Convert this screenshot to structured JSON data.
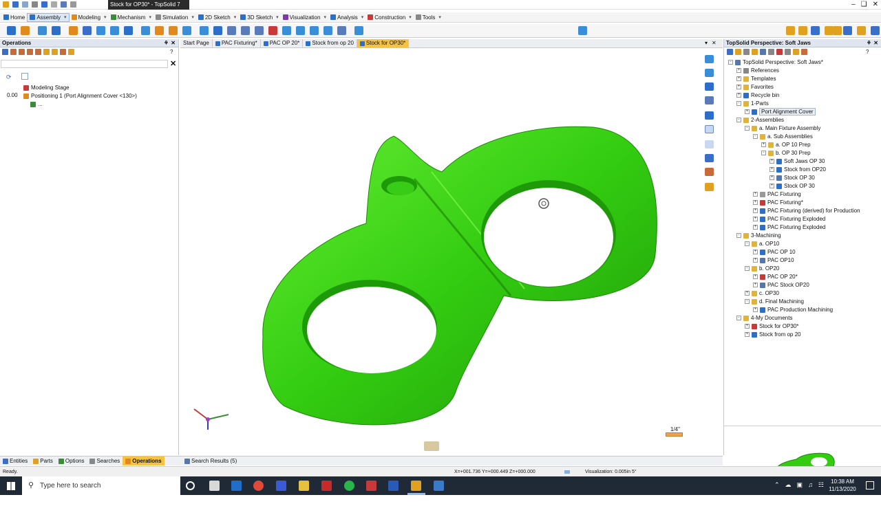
{
  "window": {
    "title": "Stock for OP30* - TopSolid 7"
  },
  "menus": [
    {
      "label": "Home",
      "color": "#2d6ec8",
      "active": false,
      "dropdown": false
    },
    {
      "label": "Assembly",
      "color": "#2d6ec8",
      "active": true,
      "dropdown": true
    },
    {
      "label": "Modeling",
      "color": "#e08a1e",
      "active": false,
      "dropdown": true
    },
    {
      "label": "Mechanism",
      "color": "#3a8c3a",
      "active": false,
      "dropdown": true
    },
    {
      "label": "Simulation",
      "color": "#888888",
      "active": false,
      "dropdown": true
    },
    {
      "label": "2D Sketch",
      "color": "#2d6ec8",
      "active": false,
      "dropdown": true
    },
    {
      "label": "3D Sketch",
      "color": "#2d6ec8",
      "active": false,
      "dropdown": true
    },
    {
      "label": "Visualization",
      "color": "#7a3aa8",
      "active": false,
      "dropdown": true
    },
    {
      "label": "Analysis",
      "color": "#2d6ec8",
      "active": false,
      "dropdown": true
    },
    {
      "label": "Construction",
      "color": "#c83a3a",
      "active": false,
      "dropdown": true
    },
    {
      "label": "Tools",
      "color": "#888888",
      "active": false,
      "dropdown": true
    }
  ],
  "left_panel": {
    "title": "Operations",
    "value_label": "0.00",
    "tree": [
      {
        "label": "Modeling Stage",
        "icon_color": "#c83a3a"
      },
      {
        "label": "Positioning 1 (Port Alignment Cover <130>)",
        "icon_color": "#e08a1e"
      },
      {
        "label": "...",
        "icon_color": "#3a8c3a"
      }
    ]
  },
  "doc_tabs": [
    {
      "label": "Start Page",
      "active": false
    },
    {
      "label": "PAC Fixturing*",
      "active": false
    },
    {
      "label": "PAC OP 20*",
      "active": false
    },
    {
      "label": "Stock from op 20",
      "active": false
    },
    {
      "label": "Stock for OP30*",
      "active": true
    }
  ],
  "right_panel": {
    "title": "TopSolid Perspective: Soft Jaws",
    "tree": [
      {
        "label": "TopSolid Perspective: Soft Jaws*",
        "depth": 0,
        "icon": "#5577aa",
        "exp": "-"
      },
      {
        "label": "References",
        "depth": 1,
        "icon": "#888888",
        "exp": "+"
      },
      {
        "label": "Templates",
        "depth": 1,
        "icon": "#e0b43a",
        "exp": "+"
      },
      {
        "label": "Favorites",
        "depth": 1,
        "icon": "#e0b43a",
        "exp": "+"
      },
      {
        "label": "Recycle bin",
        "depth": 1,
        "icon": "#2d6ec8",
        "exp": "+"
      },
      {
        "label": "1-Parts",
        "depth": 1,
        "icon": "#e0b43a",
        "exp": "-"
      },
      {
        "label": "Port Alignment Cover",
        "depth": 2,
        "icon": "#2d6ec8",
        "exp": "+",
        "highlight": true
      },
      {
        "label": "2-Assemblies",
        "depth": 1,
        "icon": "#e0b43a",
        "exp": "-"
      },
      {
        "label": "a. Main Fixture Assembly",
        "depth": 2,
        "icon": "#e0b43a",
        "exp": "-"
      },
      {
        "label": "a. Sub Assemblies",
        "depth": 3,
        "icon": "#e0b43a",
        "exp": "-"
      },
      {
        "label": "a. OP 10 Prep",
        "depth": 4,
        "icon": "#e0b43a",
        "exp": "+"
      },
      {
        "label": "b. OP 30 Prep",
        "depth": 4,
        "icon": "#e0b43a",
        "exp": "-"
      },
      {
        "label": "Soft Jaws OP 30",
        "depth": 5,
        "icon": "#2d6ec8",
        "exp": "+"
      },
      {
        "label": "Stock from OP20",
        "depth": 5,
        "icon": "#2d6ec8",
        "exp": "+"
      },
      {
        "label": "Stock OP 30",
        "depth": 5,
        "icon": "#5577aa",
        "exp": "+"
      },
      {
        "label": "Stock OP 30",
        "depth": 5,
        "icon": "#2d6ec8",
        "exp": "+"
      },
      {
        "label": "PAC Fixturing",
        "depth": 3,
        "icon": "#999999",
        "exp": "+"
      },
      {
        "label": "PAC Fixturing*",
        "depth": 3,
        "icon": "#c83a3a",
        "exp": "+"
      },
      {
        "label": "PAC Fixturing (derived) for Production",
        "depth": 3,
        "icon": "#2d6ec8",
        "exp": "+"
      },
      {
        "label": "PAC Fixturing Exploded",
        "depth": 3,
        "icon": "#2d6ec8",
        "exp": "+"
      },
      {
        "label": "PAC Fixturing Exploded",
        "depth": 3,
        "icon": "#2d6ec8",
        "exp": "+"
      },
      {
        "label": "3-Machining",
        "depth": 1,
        "icon": "#e0b43a",
        "exp": "-"
      },
      {
        "label": "a. OP10",
        "depth": 2,
        "icon": "#e0b43a",
        "exp": "-"
      },
      {
        "label": "PAC OP 10",
        "depth": 3,
        "icon": "#2d6ec8",
        "exp": "+"
      },
      {
        "label": "PAC OP10",
        "depth": 3,
        "icon": "#5577aa",
        "exp": "+"
      },
      {
        "label": "b. OP20",
        "depth": 2,
        "icon": "#e0b43a",
        "exp": "-"
      },
      {
        "label": "PAC OP 20*",
        "depth": 3,
        "icon": "#c83a3a",
        "exp": "+"
      },
      {
        "label": "PAC Stock OP20",
        "depth": 3,
        "icon": "#5577aa",
        "exp": "+"
      },
      {
        "label": "c. OP30",
        "depth": 2,
        "icon": "#e0b43a",
        "exp": "+"
      },
      {
        "label": "d. Final Machining",
        "depth": 2,
        "icon": "#e0b43a",
        "exp": "-"
      },
      {
        "label": "PAC Production Machining",
        "depth": 3,
        "icon": "#2d6ec8",
        "exp": "+"
      },
      {
        "label": "4-My Documents",
        "depth": 1,
        "icon": "#e0b43a",
        "exp": "-"
      },
      {
        "label": "Stock for OP30*",
        "depth": 2,
        "icon": "#c83a3a",
        "exp": "+"
      },
      {
        "label": "Stock from op 20",
        "depth": 2,
        "icon": "#2d6ec8",
        "exp": "+"
      }
    ]
  },
  "viewport": {
    "part_color": "#33cc11",
    "scale_label": "1/4\""
  },
  "bottom_tabs": [
    {
      "label": "Entities",
      "active": false
    },
    {
      "label": "Parts",
      "active": false
    },
    {
      "label": "Options",
      "active": false
    },
    {
      "label": "Searches",
      "active": false
    },
    {
      "label": "Operations",
      "active": true
    }
  ],
  "search_results_tab": "Search Results (5)",
  "status": {
    "left": "Ready.",
    "coords": "X=+001.736   Y=+000.449   Z=+000.000",
    "visualization": "Visualization: 0.005in 5°"
  },
  "taskbar": {
    "search_placeholder": "Type here to search",
    "time": "10:38 AM",
    "date": "11/13/2020"
  }
}
